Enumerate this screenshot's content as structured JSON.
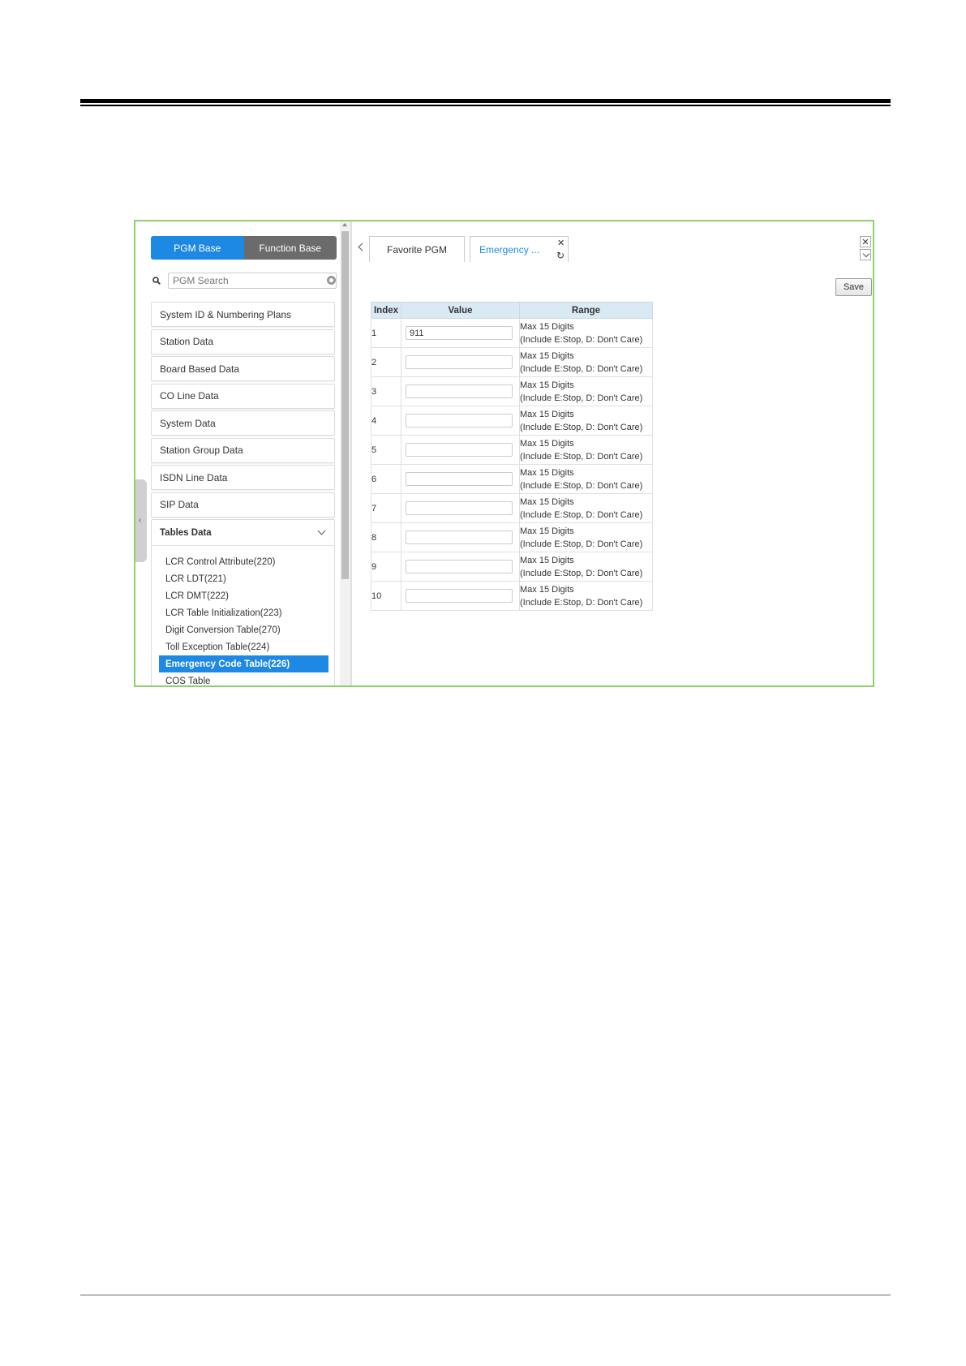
{
  "sidebar": {
    "modes": [
      "PGM Base",
      "Function Base"
    ],
    "search_placeholder": "PGM Search",
    "items": [
      "System ID & Numbering Plans",
      "Station Data",
      "Board Based Data",
      "CO Line Data",
      "System Data",
      "Station Group Data",
      "ISDN Line Data",
      "SIP Data"
    ],
    "group": {
      "title": "Tables Data",
      "items": [
        "LCR Control Attribute(220)",
        "LCR LDT(221)",
        "LCR DMT(222)",
        "LCR Table Initialization(223)",
        "Digit Conversion Table(270)",
        "Toll Exception Table(224)",
        "Emergency Code Table(226)",
        "COS Table"
      ],
      "active_index": 6
    }
  },
  "tabs": [
    "Favorite PGM",
    "Emergency ..."
  ],
  "toolbar": {
    "save_label": "Save"
  },
  "table": {
    "headers": [
      "Index",
      "Value",
      "Range"
    ],
    "range_line1": "Max 15 Digits",
    "range_line2": "(Include E:Stop, D: Don't Care)",
    "rows": [
      {
        "index": "1",
        "value": "911"
      },
      {
        "index": "2",
        "value": ""
      },
      {
        "index": "3",
        "value": ""
      },
      {
        "index": "4",
        "value": ""
      },
      {
        "index": "5",
        "value": ""
      },
      {
        "index": "6",
        "value": ""
      },
      {
        "index": "7",
        "value": ""
      },
      {
        "index": "8",
        "value": ""
      },
      {
        "index": "9",
        "value": ""
      },
      {
        "index": "10",
        "value": ""
      }
    ]
  },
  "colors": {
    "accent": "#1e88e5",
    "frame": "#8fd16a",
    "header_bg": "#daeaf5"
  }
}
